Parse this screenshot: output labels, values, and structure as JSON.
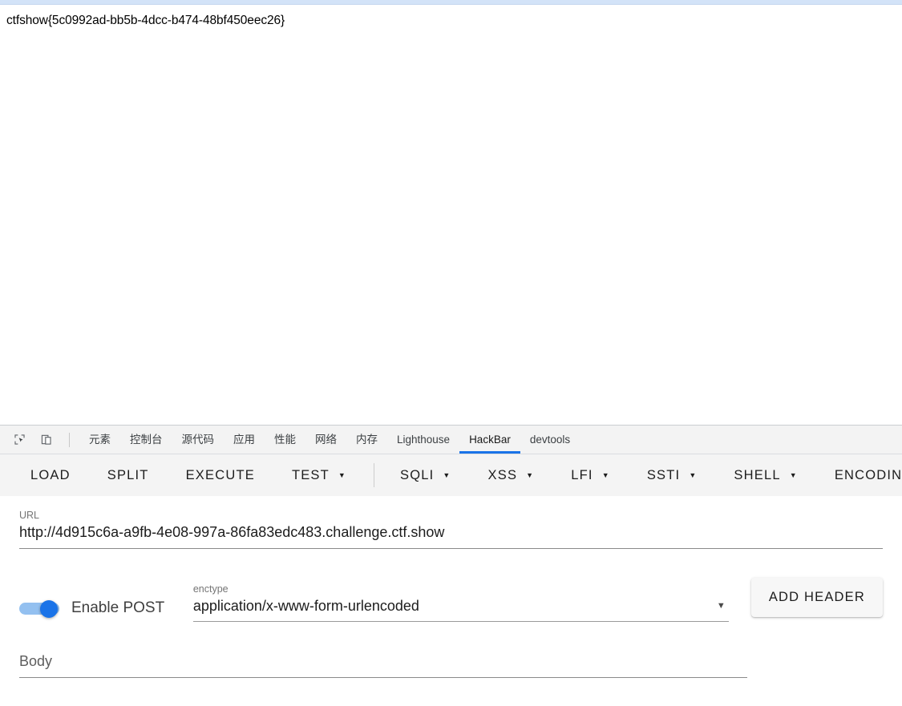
{
  "page": {
    "flag_text": "ctfshow{5c0992ad-bb5b-4dcc-b474-48bf450eec26}"
  },
  "devtools": {
    "inspect_icon": "inspect-element-icon",
    "device_icon": "device-toolbar-icon",
    "tabs": [
      {
        "label": "元素",
        "name": "elements",
        "selected": false
      },
      {
        "label": "控制台",
        "name": "console",
        "selected": false
      },
      {
        "label": "源代码",
        "name": "sources",
        "selected": false
      },
      {
        "label": "应用",
        "name": "application",
        "selected": false
      },
      {
        "label": "性能",
        "name": "performance",
        "selected": false
      },
      {
        "label": "网络",
        "name": "network",
        "selected": false
      },
      {
        "label": "内存",
        "name": "memory",
        "selected": false
      },
      {
        "label": "Lighthouse",
        "name": "lighthouse",
        "selected": false
      },
      {
        "label": "HackBar",
        "name": "hackbar",
        "selected": true
      },
      {
        "label": "devtools",
        "name": "devtools",
        "selected": false
      }
    ],
    "selected_tab": "HackBar",
    "accent_color": "#1a73e8"
  },
  "hackbar": {
    "toolbar": {
      "actions": [
        {
          "label": "LOAD",
          "has_caret": false
        },
        {
          "label": "SPLIT",
          "has_caret": false
        },
        {
          "label": "EXECUTE",
          "has_caret": false
        },
        {
          "label": "TEST",
          "has_caret": true
        }
      ],
      "payloads": [
        {
          "label": "SQLI",
          "has_caret": true
        },
        {
          "label": "XSS",
          "has_caret": true
        },
        {
          "label": "LFI",
          "has_caret": true
        },
        {
          "label": "SSTI",
          "has_caret": true
        },
        {
          "label": "SHELL",
          "has_caret": true
        },
        {
          "label": "ENCODING",
          "has_caret": true
        }
      ],
      "caret_glyph": "▼"
    },
    "url": {
      "label": "URL",
      "value": "http://4d915c6a-a9fb-4e08-997a-86fa83edc483.challenge.ctf.show"
    },
    "post": {
      "toggle_label": "Enable POST",
      "enabled": true
    },
    "enctype": {
      "label": "enctype",
      "value": "application/x-www-form-urlencoded",
      "caret_glyph": "▼"
    },
    "add_header_label": "ADD HEADER",
    "body": {
      "label": "Body",
      "value": ""
    }
  }
}
